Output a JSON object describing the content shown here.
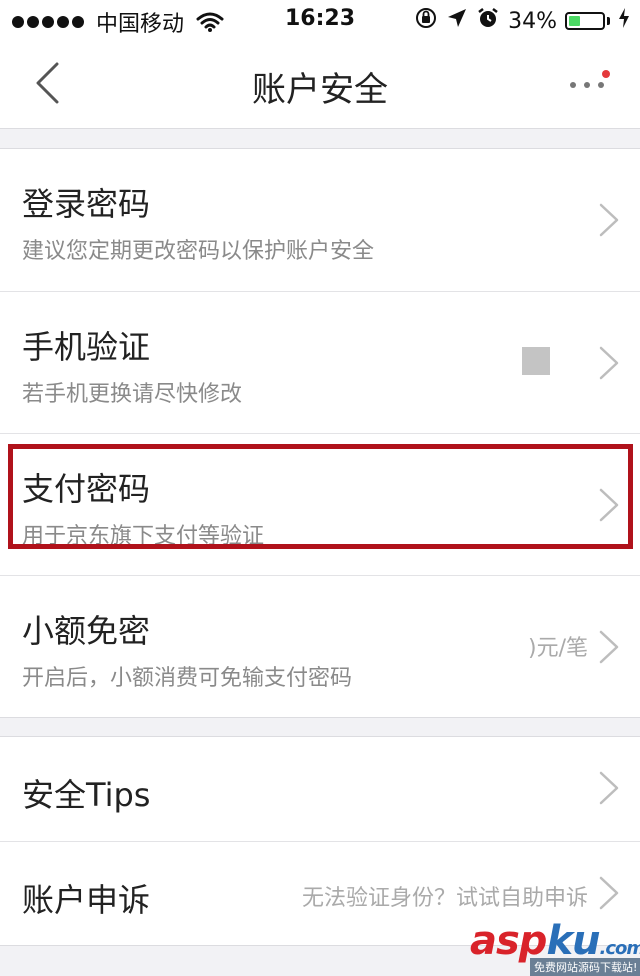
{
  "status_bar": {
    "carrier": "中国移动",
    "time": "16:23",
    "battery_percent_text": "34%",
    "battery_level": 0.34,
    "icons": [
      "signal-icon",
      "wifi-icon",
      "rotation-lock-icon",
      "location-icon",
      "alarm-icon",
      "battery-icon",
      "charging-icon"
    ]
  },
  "nav": {
    "title": "账户安全",
    "back_icon": "back-chevron-icon",
    "more_icon": "more-dots-icon",
    "badge_color": "#e4393c"
  },
  "settings_group_1": [
    {
      "title": "登录密码",
      "subtitle": "建议您定期更改密码以保护账户安全",
      "value": ""
    },
    {
      "title": "手机验证",
      "subtitle": "若手机更换请尽快修改",
      "value": ""
    },
    {
      "title": "支付密码",
      "subtitle": "用于京东旗下支付等验证",
      "value": ""
    },
    {
      "title": "小额免密",
      "subtitle": "开启后，小额消费可免输支付密码",
      "value": ")元/笔"
    }
  ],
  "settings_group_2": [
    {
      "title": "安全Tips",
      "value": ""
    },
    {
      "title": "账户申诉",
      "value": "无法验证身份？试试自助申诉"
    }
  ],
  "highlight_color": "#b0121b",
  "watermark": {
    "logo_a": "asp",
    "logo_k": "ku",
    "logo_tld": ".com",
    "subtitle": "免费网站源码下载站!"
  }
}
